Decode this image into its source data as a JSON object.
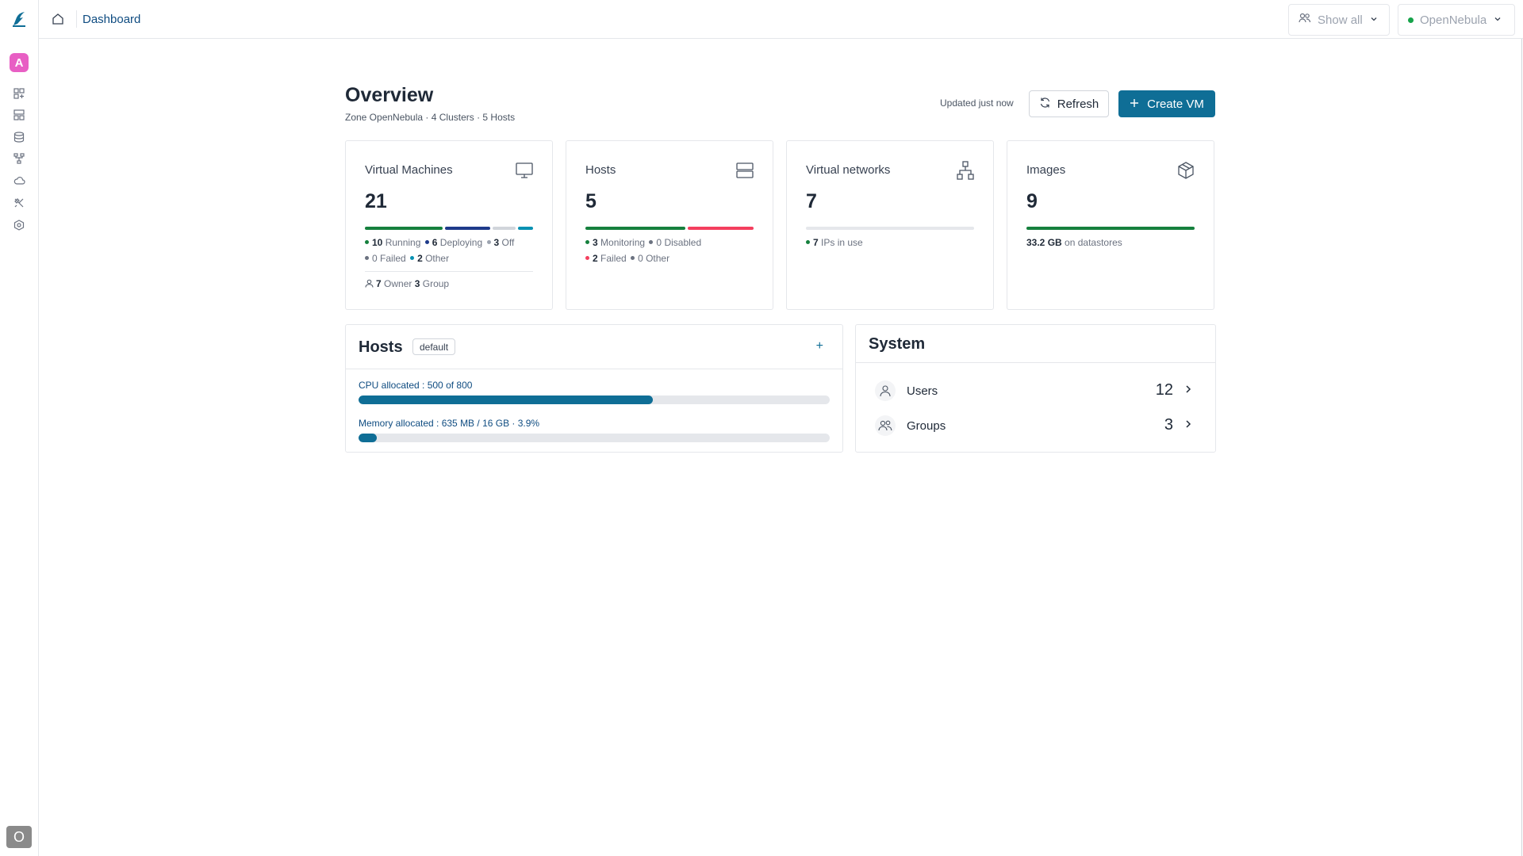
{
  "topbar": {
    "breadcrumb": "Dashboard",
    "view_filter": "Show all",
    "zone_selector": "OpenNebula"
  },
  "sidebar": {
    "avatar_letter": "A",
    "user_initial": "O",
    "items": [
      "dashboard-icon",
      "instances-icon",
      "storage-icon",
      "network-icon",
      "cloud-icon",
      "tools-icon",
      "system-icon"
    ]
  },
  "header": {
    "title": "Overview",
    "subtitle": "Zone OpenNebula · 4 Clusters · 5 Hosts",
    "updated": "Updated just now",
    "refresh_label": "Refresh",
    "create_label": "Create VM"
  },
  "cards": {
    "vms": {
      "title": "Virtual Machines",
      "value": "21",
      "running": "10",
      "running_label": "Running",
      "deploying": "6",
      "deploying_label": "Deploying",
      "off": "3",
      "off_label": "Off",
      "failed": "0",
      "failed_label": "Failed",
      "other": "2",
      "other_label": "Other",
      "owner": "7",
      "owner_label": "Owner",
      "group": "3",
      "group_label": "Group"
    },
    "hosts": {
      "title": "Hosts",
      "value": "5",
      "monitoring": "3",
      "monitoring_label": "Monitoring",
      "disabled": "0",
      "disabled_label": "Disabled",
      "failed": "2",
      "failed_label": "Failed",
      "other": "0",
      "other_label": "Other"
    },
    "networks": {
      "title": "Virtual networks",
      "value": "7",
      "ips": "7",
      "ips_label": "IPs in use"
    },
    "images": {
      "title": "Images",
      "value": "9",
      "size": "33.2 GB",
      "size_label": "on datastores"
    }
  },
  "hosts_panel": {
    "title": "Hosts",
    "badge": "default",
    "add": "+",
    "cpu_label": "CPU allocated : 500 of 800",
    "cpu_fraction": 0.625,
    "mem_label": "Memory allocated : 635 MB / 16 GB · 3.9%",
    "mem_fraction": 0.039
  },
  "system_panel": {
    "title": "System",
    "users_label": "Users",
    "users_count": "12",
    "groups_label": "Groups",
    "groups_count": "3"
  },
  "colors": {
    "primary": "#0f6e96",
    "running": "#15803d",
    "deploying": "#1e3a8a",
    "off": "#9ca3af",
    "other": "#0891b2",
    "failed": "#f43f5e"
  }
}
